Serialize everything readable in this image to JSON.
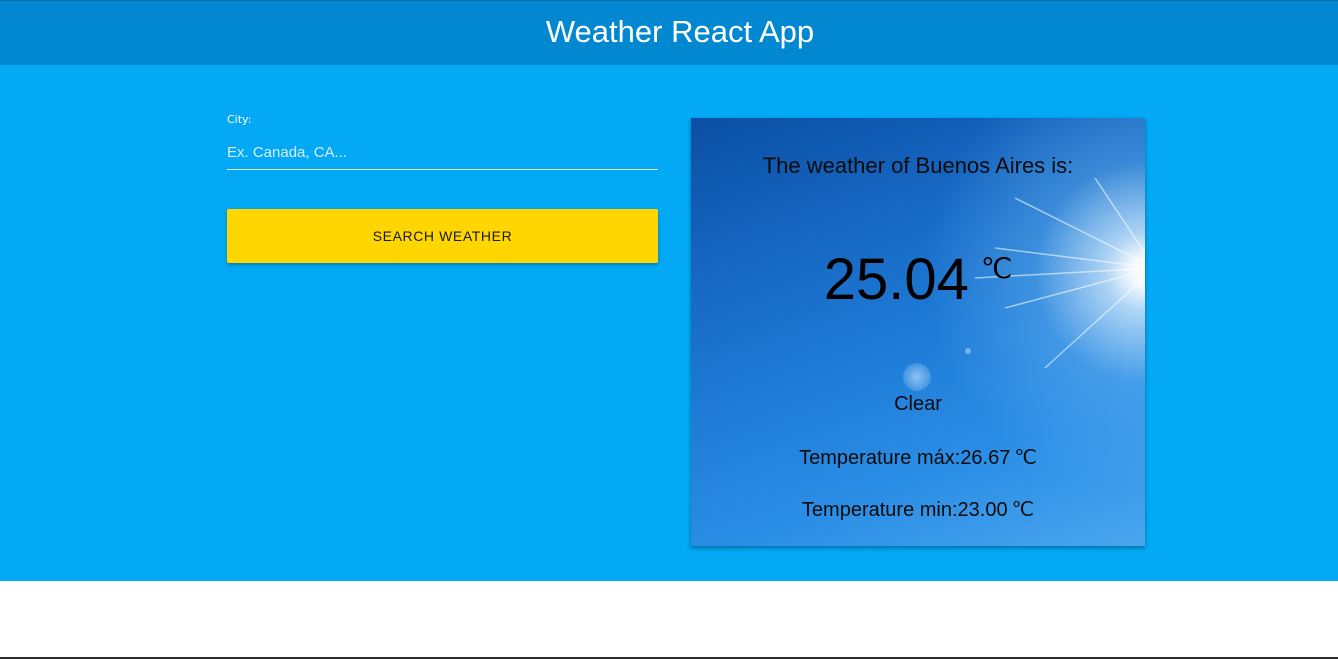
{
  "header": {
    "title": "Weather React App"
  },
  "form": {
    "city_label": "City:",
    "city_placeholder": "Ex. Canada, CA...",
    "city_value": "",
    "search_button_label": "SEARCH WEATHER"
  },
  "weather_card": {
    "heading": "The weather of Buenos Aires is:",
    "temperature": "25.04",
    "unit": "℃",
    "condition": "Clear",
    "temp_max_text": "Temperature máx:26.67",
    "temp_max_unit": "℃",
    "temp_min_text": "Temperature min:23.00",
    "temp_min_unit": "℃",
    "background_icon": "sunny-sky-image"
  },
  "colors": {
    "header_bg": "#0288d1",
    "main_bg": "#03a9f4",
    "button_bg": "#ffd600"
  }
}
